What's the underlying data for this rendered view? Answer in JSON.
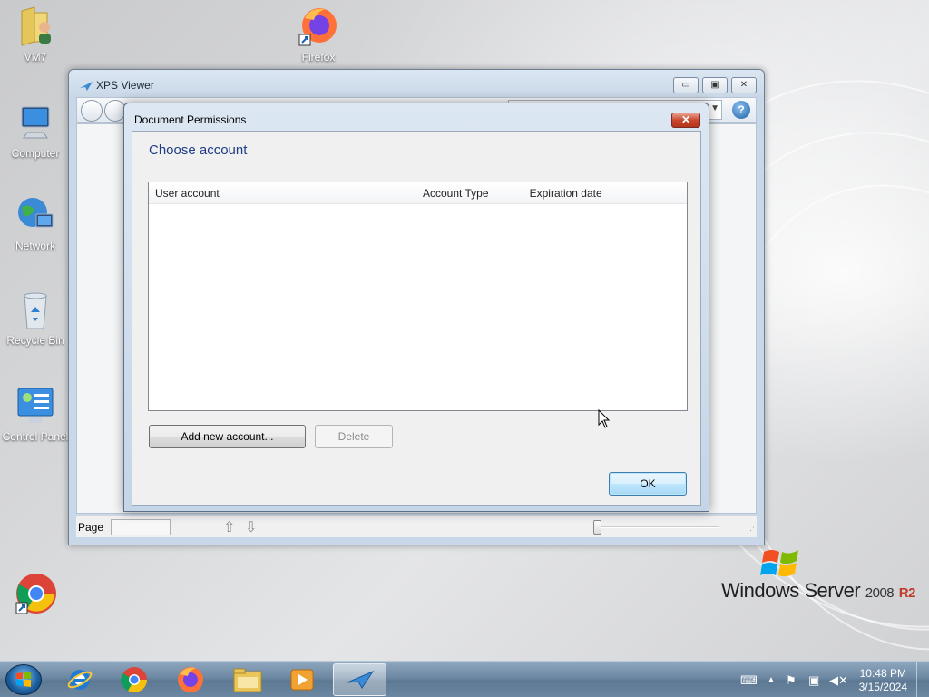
{
  "desktop": {
    "icons": [
      {
        "label": "VM7",
        "icon": "user-folder-icon"
      },
      {
        "label": "Firefox",
        "icon": "firefox-icon"
      },
      {
        "label": "Computer",
        "icon": "computer-icon"
      },
      {
        "label": "Network",
        "icon": "network-icon"
      },
      {
        "label": "Recycle Bin",
        "icon": "recycle-bin-icon"
      },
      {
        "label": "Control Panel",
        "icon": "control-panel-icon"
      },
      {
        "label": "",
        "icon": "chrome-icon"
      }
    ]
  },
  "xps_window": {
    "title": "XPS Viewer",
    "caption_buttons": {
      "minimize": "▭",
      "maximize": "▣",
      "close": "✕"
    },
    "status_bar": {
      "page_label": "Page",
      "page_value": ""
    }
  },
  "dialog": {
    "title": "Document Permissions",
    "close_glyph": "✕",
    "heading": "Choose account",
    "columns": [
      "User account",
      "Account Type",
      "Expiration date"
    ],
    "rows": [],
    "buttons": {
      "add_account": "Add new account...",
      "delete": "Delete",
      "ok": "OK"
    }
  },
  "branding": {
    "os_name": "Windows Server",
    "version": "2008",
    "edition": "R2"
  },
  "taskbar": {
    "apps": [
      {
        "name": "internet-explorer-icon"
      },
      {
        "name": "chrome-icon"
      },
      {
        "name": "firefox-icon"
      },
      {
        "name": "file-explorer-icon"
      },
      {
        "name": "media-player-icon"
      },
      {
        "name": "xps-viewer-icon",
        "active": true
      }
    ],
    "clock": {
      "time": "10:48 PM",
      "date": "3/15/2024"
    }
  },
  "colors": {
    "heading_blue": "#1e3d84",
    "close_red": "#c9462d",
    "ok_border": "#3c7fb1"
  }
}
